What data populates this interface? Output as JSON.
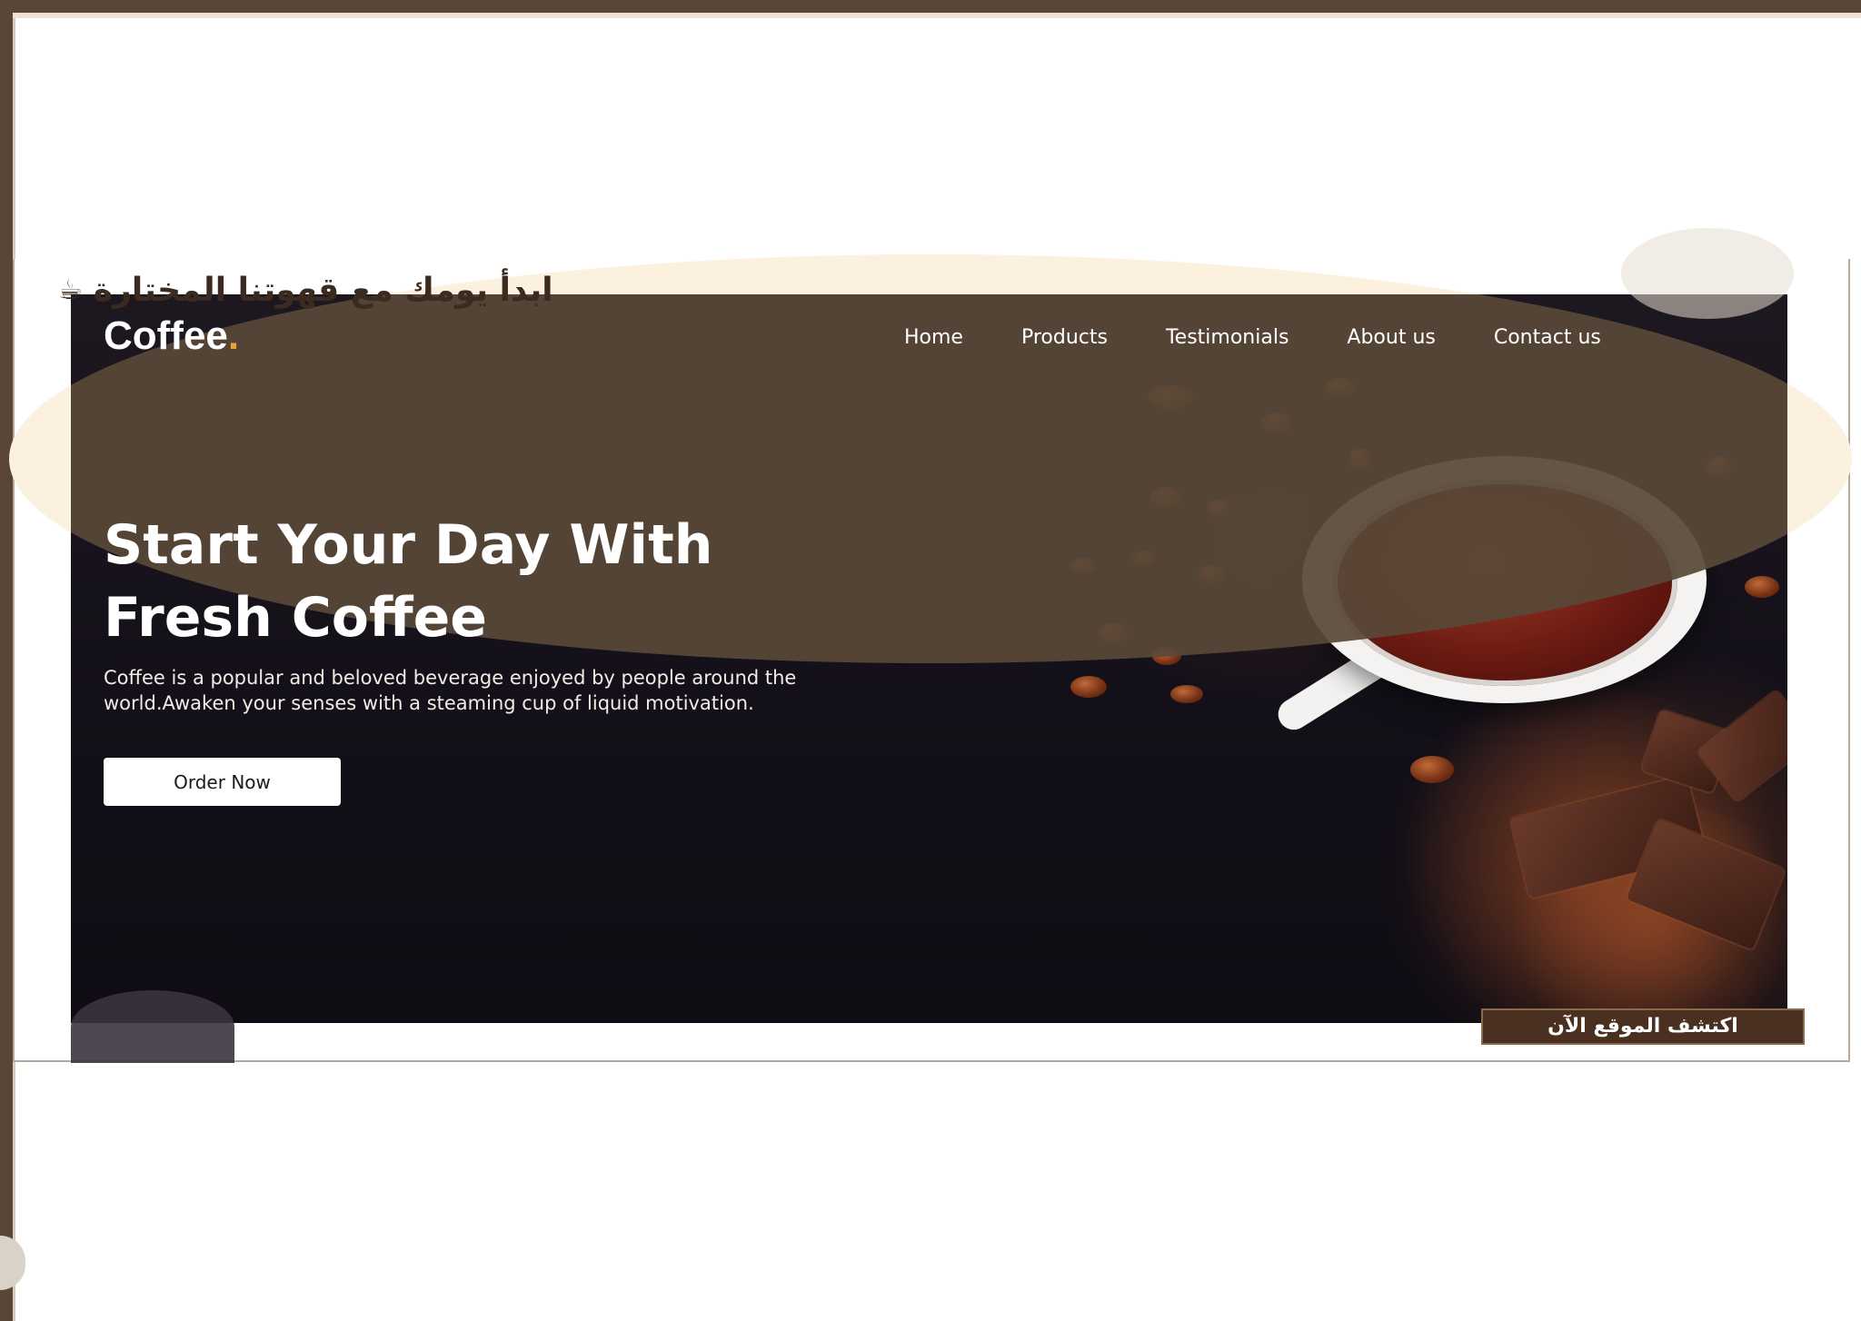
{
  "tagline": {
    "icon": "coffee-cup-icon",
    "text": "ابدأ يومك مع قهوتنا المختارة"
  },
  "brand": {
    "name": "Coffee",
    "dot": ".",
    "dot_color": "#e6a23c"
  },
  "nav": {
    "items": [
      {
        "label": "Home"
      },
      {
        "label": "Products"
      },
      {
        "label": "Testimonials"
      },
      {
        "label": "About us"
      },
      {
        "label": "Contact us"
      }
    ]
  },
  "hero": {
    "headline_line1": "Start Your Day With",
    "headline_line2": "Fresh Coffee",
    "description_line1": "Coffee is a popular and beloved beverage enjoyed by people around the",
    "description_line2": "world.Awaken your senses with a steaming cup of liquid motivation.",
    "cta_label": "Order Now"
  },
  "explore_button": {
    "label": "اكتشف الموقع الآن"
  },
  "colors": {
    "frame": "#5a4636",
    "overlay": "#584838",
    "beige": "#fcf1df",
    "accent": "#e6a23c",
    "explore_bg": "#4a3020"
  }
}
